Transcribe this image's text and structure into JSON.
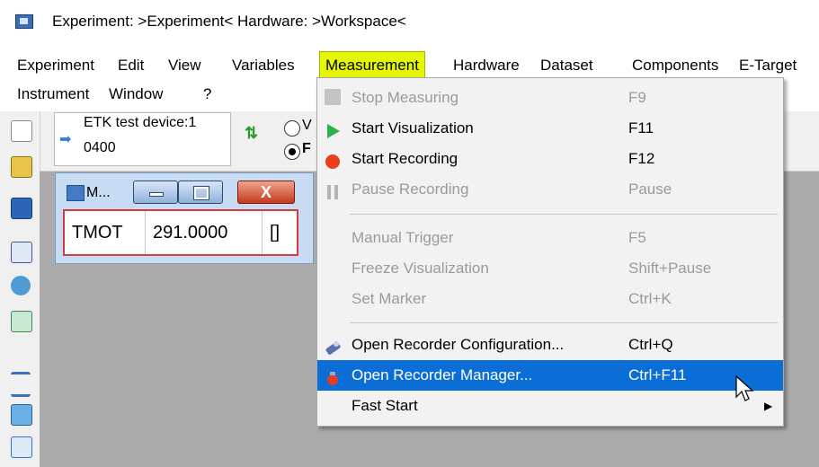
{
  "window": {
    "title": "Experiment: >Experiment< Hardware: >Workspace<"
  },
  "menubar": {
    "row1": [
      "Experiment",
      "Edit",
      "View",
      "Variables",
      "Measurement",
      "Hardware",
      "Dataset",
      "Components",
      "E-Target"
    ],
    "row2": [
      "Instrument",
      "Window",
      "?"
    ]
  },
  "toolbar": {
    "device_line1": "ETK test device:1",
    "device_line2": "0400",
    "radio1_label": "V",
    "radio2_label": "F"
  },
  "measure_window": {
    "title": "M...",
    "close_glyph": "X",
    "signal_name": "TMOT",
    "signal_value": "291.0000",
    "signal_unit": "[]"
  },
  "measurement_menu": {
    "items": [
      {
        "label": "Stop Measuring",
        "shortcut": "F9",
        "enabled": false,
        "icon": "stop-icon"
      },
      {
        "label": "Start Visualization",
        "shortcut": "F11",
        "enabled": true,
        "icon": "play-icon"
      },
      {
        "label": "Start Recording",
        "shortcut": "F12",
        "enabled": true,
        "icon": "record-icon"
      },
      {
        "label": "Pause Recording",
        "shortcut": "Pause",
        "enabled": false,
        "icon": "pause-icon"
      },
      {
        "label": "Manual Trigger",
        "shortcut": "F5",
        "enabled": false
      },
      {
        "label": "Freeze Visualization",
        "shortcut": "Shift+Pause",
        "enabled": false
      },
      {
        "label": "Set Marker",
        "shortcut": "Ctrl+K",
        "enabled": false
      },
      {
        "label": "Open Recorder Configuration...",
        "shortcut": "Ctrl+Q",
        "enabled": true,
        "icon": "recorder-config-icon"
      },
      {
        "label": "Open Recorder Manager...",
        "shortcut": "Ctrl+F11",
        "enabled": true,
        "icon": "recorder-manager-icon",
        "highlighted": true
      },
      {
        "label": "Fast Start",
        "shortcut": "",
        "enabled": true,
        "submenu": true
      }
    ]
  },
  "colors": {
    "menu_highlight": "#0b6ed6",
    "measurement_menu_highlight": "#e4f600",
    "workspace_bg": "#ababab"
  }
}
